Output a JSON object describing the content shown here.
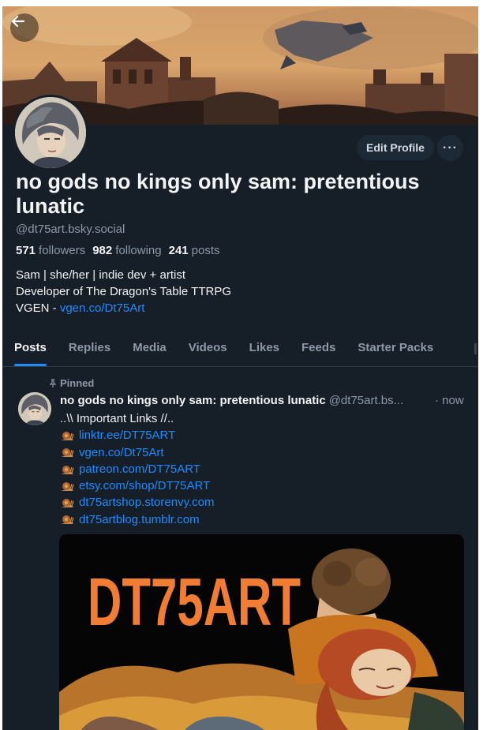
{
  "profile": {
    "display_name": "no gods no kings only sam: pretentious lunatic",
    "handle": "@dt75art.bsky.social",
    "followers_count": "571",
    "followers_label": "followers",
    "following_count": "982",
    "following_label": "following",
    "posts_count": "241",
    "posts_label": "posts",
    "bio_line1": "Sam | she/her | indie dev + artist",
    "bio_line2": "Developer of The Dragon's Table TTRPG",
    "bio_line3_prefix": "VGEN - ",
    "bio_line3_link": "vgen.co/Dt75Art"
  },
  "actions": {
    "edit_profile": "Edit Profile",
    "more": "···"
  },
  "tabs": [
    {
      "label": "Posts",
      "active": true
    },
    {
      "label": "Replies"
    },
    {
      "label": "Media"
    },
    {
      "label": "Videos"
    },
    {
      "label": "Likes"
    },
    {
      "label": "Feeds"
    },
    {
      "label": "Starter Packs"
    }
  ],
  "post": {
    "pinned_label": "Pinned",
    "author": "no gods no kings only sam: pretentious lunatic",
    "handle": "@dt75art.bs...",
    "time": "· now",
    "intro": "..\\\\ Important Links //..",
    "links": [
      "linktr.ee/DT75ART",
      "vgen.co/Dt75Art",
      "patreon.com/DT75ART",
      "etsy.com/shop/DT75ART",
      "dt75artshop.storenvy.com",
      "dt75artblog.tumblr.com"
    ],
    "image_text": "DT75ART"
  },
  "colors": {
    "background": "#161e27",
    "accent": "#208bfe",
    "muted": "#8d99a6",
    "image_title": "#f07d33"
  },
  "icons": {
    "back": "arrow-left-icon",
    "pin": "pin-icon",
    "link_bullet": "snail-icon"
  }
}
